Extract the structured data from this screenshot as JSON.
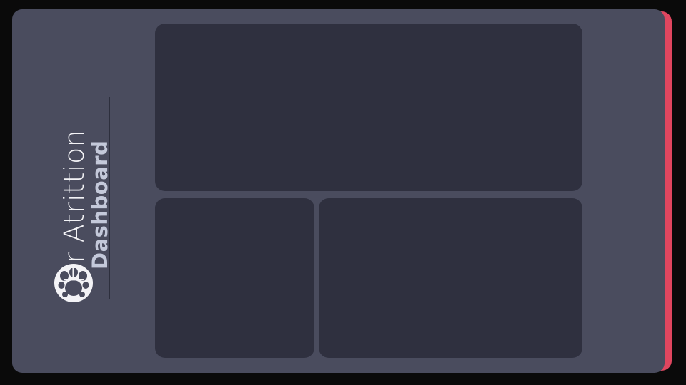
{
  "dashboard": {
    "title_line1": "Hr Atrittion",
    "title_line2": "Dashboard",
    "logo_icon": "paw-icon"
  },
  "colors": {
    "background": "#0a0a0a",
    "panel": "#4a4c5e",
    "card": "#2f303f",
    "accent": "#e0465f",
    "title_primary": "#f3f3f6",
    "title_secondary": "#c4c9da"
  }
}
